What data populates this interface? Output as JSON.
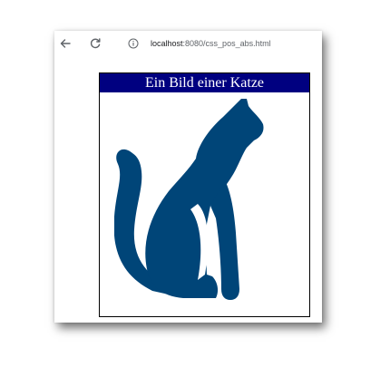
{
  "browser": {
    "url_host": "localhost",
    "url_path": ":8080/css_pos_abs.html",
    "back_icon": "arrow-left-icon",
    "reload_icon": "reload-icon",
    "info_icon": "info-icon"
  },
  "page": {
    "caption": "Ein Bild einer Katze",
    "caption_bg": "#000080",
    "caption_color": "#ffffff",
    "cat_color": "#004578"
  }
}
